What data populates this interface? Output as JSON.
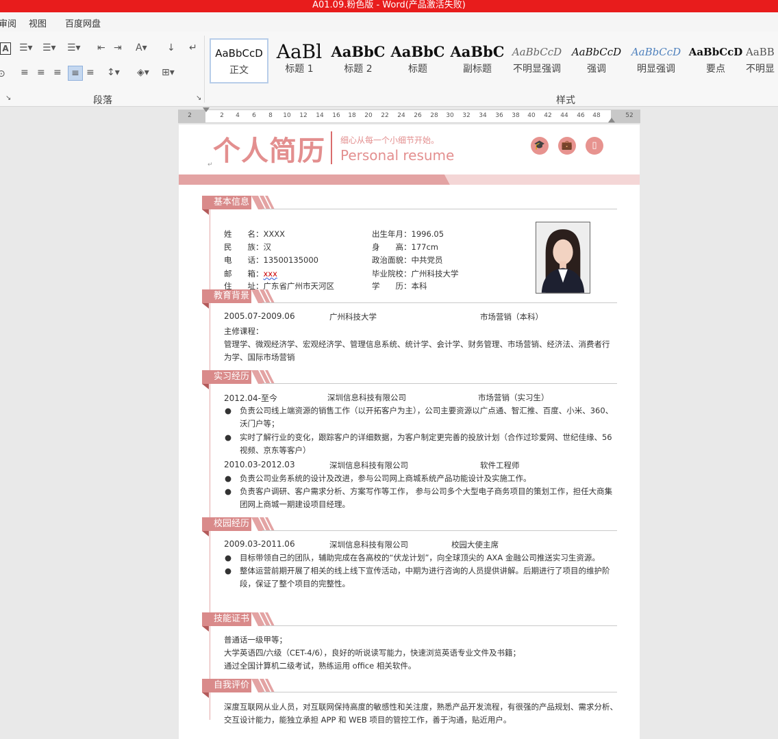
{
  "window": {
    "title": "A01.09.粉色版 -  Word(产品激活失败)"
  },
  "menu": [
    "审阅",
    "视图",
    "百度网盘"
  ],
  "ribbon": {
    "paragraph_label": "段落",
    "styles_label": "样式",
    "styles": [
      {
        "sample": "AaBbCcD",
        "name": "正文",
        "selected": true
      },
      {
        "sample": "AaBl",
        "name": "标题 1"
      },
      {
        "sample": "AaBbC",
        "name": "标题 2"
      },
      {
        "sample": "AaBbC",
        "name": "标题"
      },
      {
        "sample": "AaBbC",
        "name": "副标题"
      },
      {
        "sample": "AaBbCcD",
        "name": "不明显强调"
      },
      {
        "sample": "AaBbCcD",
        "name": "强调"
      },
      {
        "sample": "AaBbCcD",
        "name": "明显强调"
      },
      {
        "sample": "AaBbCcD",
        "name": "要点"
      },
      {
        "sample": "AaBB",
        "name": "不明显"
      }
    ]
  },
  "ruler": {
    "ticks": [
      "2",
      "2",
      "4",
      "6",
      "8",
      "10",
      "12",
      "14",
      "16",
      "18",
      "20",
      "22",
      "24",
      "26",
      "28",
      "30",
      "32",
      "34",
      "36",
      "38",
      "40",
      "42",
      "44",
      "46",
      "48",
      "52"
    ]
  },
  "resume": {
    "title": "个人简历",
    "slogan": "细心从每一个小细节开始。",
    "english": "Personal resume",
    "accent": "#e38f8f",
    "sections": {
      "basic": "基本信息",
      "education": "教育背景",
      "internship": "实习经历",
      "campus": "校园经历",
      "skills": "技能证书",
      "self": "自我评价"
    },
    "basic": {
      "left": [
        {
          "label": "姓　　名：",
          "value": "XXXX"
        },
        {
          "label": "民　　族：",
          "value": "汉"
        },
        {
          "label": "电　　话：",
          "value": "13500135000"
        },
        {
          "label": "邮　　箱：",
          "value": "xxx"
        },
        {
          "label": "住　　址：",
          "value": "广东省广州市天河区"
        }
      ],
      "right": [
        {
          "label": "出生年月：",
          "value": "1996.05"
        },
        {
          "label": "身　　高：",
          "value": "177cm"
        },
        {
          "label": "政治面貌：",
          "value": "中共党员"
        },
        {
          "label": "毕业院校：",
          "value": "广州科技大学"
        },
        {
          "label": "学　　历：",
          "value": "本科"
        }
      ]
    },
    "education": {
      "period": "2005.07-2009.06",
      "school": "广州科技大学",
      "major": "市场营销（本科）",
      "courses_label": "主修课程：",
      "courses_line1": "管理学、微观经济学、宏观经济学、管理信息系统、统计学、会计学、财务管理、市场营销、经济法、消费者行",
      "courses_line2": "为学、国际市场营销"
    },
    "internship": [
      {
        "period": "2012.04-至今",
        "company": "深圳信息科技有限公司",
        "role": "市场营销（实习生）",
        "bullets": [
          {
            "l1": "负责公司线上端资源的销售工作（以开拓客户为主），公司主要资源以广点通、智汇推、百度、小米、360、",
            "l2": "沃门户等；"
          },
          {
            "l1": "实时了解行业的变化，跟踪客户的详细数据，为客户制定更完善的投放计划（合作过珍爱网、世纪佳缘、56",
            "l2": "视频、京东等客户）"
          }
        ]
      },
      {
        "period": "2010.03-2012.03",
        "company": "深圳信息科技有限公司",
        "role": "软件工程师",
        "bullets": [
          {
            "l1": "负责公司业务系统的设计及改进，参与公司网上商城系统产品功能设计及实施工作。",
            "l2": ""
          },
          {
            "l1": "负责客户调研、客户需求分析、方案写作等工作，  参与公司多个大型电子商务项目的策划工作，担任大商集",
            "l2": "团网上商城一期建设项目经理。"
          }
        ]
      }
    ],
    "campus": {
      "period": "2009.03-2011.06",
      "company": "深圳信息科技有限公司",
      "role": "校园大使主席",
      "bullets": [
        {
          "l1": "目标带领自己的团队，辅助完成在各高校的“伏龙计划”，向全球顶尖的 AXA 金融公司推送实习生资源。",
          "l2": ""
        },
        {
          "l1": "整体运营前期开展了相关的线上线下宣传活动，中期为进行咨询的人员提供讲解。后期进行了项目的维护阶",
          "l2": "段，保证了整个项目的完整性。"
        }
      ]
    },
    "skills": [
      "普通话一级甲等；",
      "大学英语四/六级（CET-4/6），良好的听说读写能力，快速浏览英语专业文件及书籍；",
      "通过全国计算机二级考试，熟练运用 office 相关软件。"
    ],
    "self": {
      "l1": "深度互联网从业人员，对互联网保持高度的敏感性和关注度，熟悉产品开发流程，有很强的产品规划、需求分析、",
      "l2": "交互设计能力，能独立承担 APP 和 WEB 项目的管控工作，善于沟通，贴近用户。"
    }
  }
}
